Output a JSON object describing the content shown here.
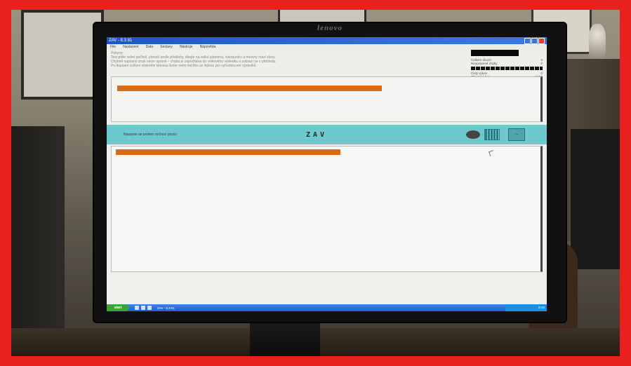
{
  "monitor": {
    "brand": "lenovo"
  },
  "window": {
    "title": "ZAV - 8.3.81",
    "menu": [
      "File",
      "Nastavení",
      "Data",
      "Sestavy",
      "Nástroje",
      "Nápověda"
    ]
  },
  "instructions": {
    "label": "Pokyny:",
    "lines": [
      "Text pište velmi pečlivě, přesně podle předlohy, dbejte na velká písmena, interpunkci a mezery mezi slovy.",
      "Chybně napsaný znak nelze opravit – chyba je započítána do celkového výsledku a zobrazí se v přehledu.",
      "Po dopsání cvičení stiskněte klávesu Enter nebo tlačítko se šipkou pro vyhodnocení výsledků."
    ]
  },
  "stats": {
    "rows": [
      {
        "label": "Celkem úhozů",
        "value": "0"
      },
      {
        "label": "Neopravené chyby",
        "value": "0"
      },
      {
        "label": "Čistý výkon",
        "value": "0"
      },
      {
        "label": "Zbývající čas",
        "value": "10:00"
      }
    ]
  },
  "cyan_bar": {
    "hint": "Nastavte se prstem výchozí pozici",
    "word": "ZAV",
    "enter": "→"
  },
  "taskbar": {
    "start": "start",
    "task": "ZAV - 8.3.81",
    "tray_time": "8:15"
  }
}
